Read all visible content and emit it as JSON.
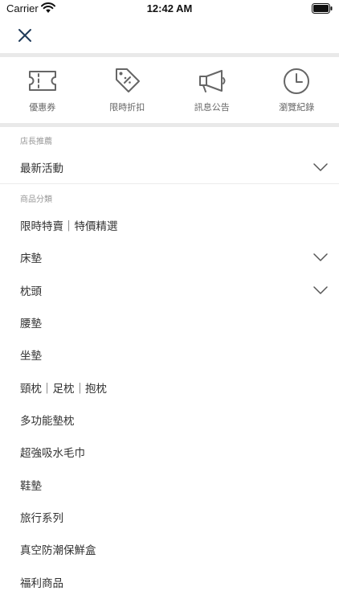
{
  "status_bar": {
    "carrier": "Carrier",
    "time": "12:42 AM"
  },
  "nav": {
    "close_icon": "close-icon"
  },
  "quick_links": [
    {
      "label": "優惠券",
      "icon": "ticket-icon"
    },
    {
      "label": "限時折扣",
      "icon": "discount-tag-icon"
    },
    {
      "label": "訊息公告",
      "icon": "megaphone-icon"
    },
    {
      "label": "瀏覽紀錄",
      "icon": "clock-icon"
    }
  ],
  "recommend_section": {
    "label": "店長推薦",
    "items": [
      {
        "label": "最新活動",
        "expandable": true
      }
    ]
  },
  "category_section": {
    "label": "商品分類",
    "items": [
      {
        "label": "限時特賣｜特價精選",
        "expandable": false
      },
      {
        "label": "床墊",
        "expandable": true
      },
      {
        "label": "枕頭",
        "expandable": true
      },
      {
        "label": "腰墊",
        "expandable": false
      },
      {
        "label": "坐墊",
        "expandable": false
      },
      {
        "label": "頸枕｜足枕｜抱枕",
        "expandable": false
      },
      {
        "label": "多功能墊枕",
        "expandable": false
      },
      {
        "label": "超強吸水毛巾",
        "expandable": false
      },
      {
        "label": "鞋墊",
        "expandable": false
      },
      {
        "label": "旅行系列",
        "expandable": false
      },
      {
        "label": "真空防潮保鮮盒",
        "expandable": false
      },
      {
        "label": "福利商品",
        "expandable": false
      }
    ]
  },
  "colors": {
    "icon": "#666666",
    "divider": "#e9e9e9",
    "text": "#333333",
    "muted": "#999999",
    "close": "#1f3a5a"
  }
}
